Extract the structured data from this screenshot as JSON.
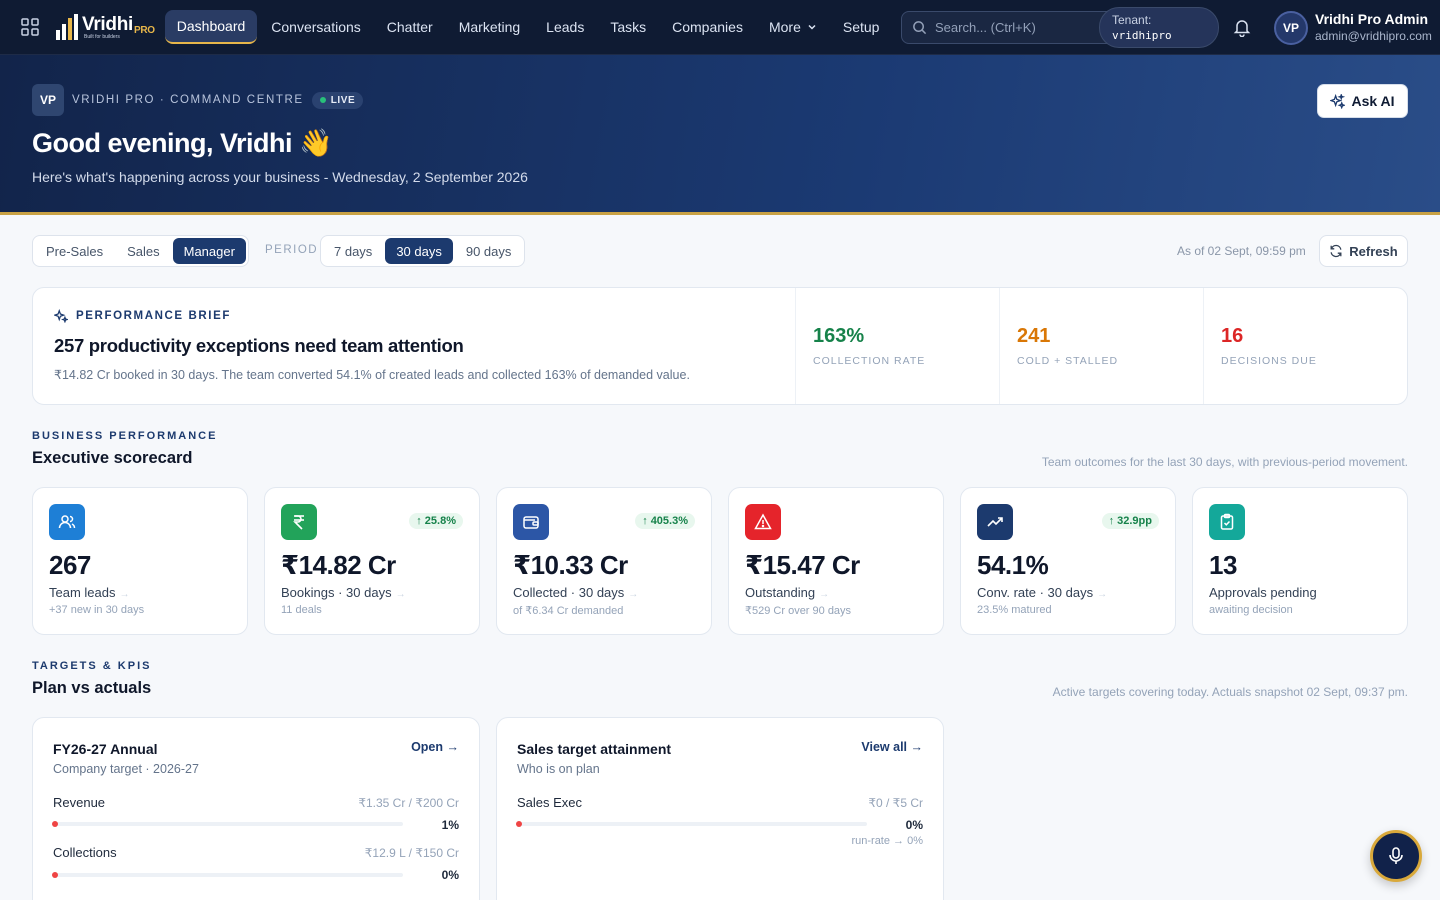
{
  "nav": {
    "logo_name": "Vridhi",
    "logo_suffix": "PRO",
    "logo_tagline": "Built for builders",
    "items": [
      {
        "label": "Dashboard",
        "active": true
      },
      {
        "label": "Conversations"
      },
      {
        "label": "Chatter"
      },
      {
        "label": "Marketing"
      },
      {
        "label": "Leads"
      },
      {
        "label": "Tasks"
      },
      {
        "label": "Companies"
      },
      {
        "label": "More"
      },
      {
        "label": "Setup"
      }
    ],
    "search_placeholder": "Search... (Ctrl+K)",
    "tenant_label": "Tenant:",
    "tenant_value": "vridhipro",
    "avatar_initials": "VP",
    "user_name": "Vridhi Pro Admin",
    "user_email": "admin@vridhipro.com"
  },
  "hero": {
    "badge": "VP",
    "kicker": "VRIDHI PRO · COMMAND CENTRE",
    "live": "LIVE",
    "title": "Good evening, Vridhi 👋",
    "subtitle": "Here's what's happening across your business - Wednesday, 2 September 2026",
    "ask_ai": "Ask AI"
  },
  "toolbar": {
    "views": [
      {
        "label": "Pre-Sales"
      },
      {
        "label": "Sales"
      },
      {
        "label": "Manager",
        "active": true
      }
    ],
    "period_label": "PERIOD",
    "periods": [
      {
        "label": "7 days"
      },
      {
        "label": "30 days",
        "active": true
      },
      {
        "label": "90 days"
      }
    ],
    "as_of": "As of 02 Sept, 09:59 pm",
    "refresh": "Refresh"
  },
  "brief": {
    "kicker": "PERFORMANCE BRIEF",
    "title": "257 productivity exceptions need team attention",
    "text": "₹14.82 Cr booked in 30 days. The team converted 54.1% of created leads and collected 163% of demanded value.",
    "stats": [
      {
        "value": "163%",
        "label": "COLLECTION RATE",
        "color": "#16824a"
      },
      {
        "value": "241",
        "label": "COLD + STALLED",
        "color": "#d97706"
      },
      {
        "value": "16",
        "label": "DECISIONS DUE",
        "color": "#dc2626"
      }
    ]
  },
  "scorecard": {
    "kicker": "BUSINESS PERFORMANCE",
    "title": "Executive scorecard",
    "note": "Team outcomes for the last 30 days, with previous-period movement.",
    "cards": [
      {
        "icon": "users-icon",
        "color": "#1e7fd6",
        "value": "267",
        "label": "Team leads",
        "sub": "+37 new in 30 days",
        "delta": ""
      },
      {
        "icon": "rupee-icon",
        "color": "#22a35a",
        "value": "₹14.82 Cr",
        "label": "Bookings · 30 days",
        "sub": "11 deals",
        "delta": "25.8%"
      },
      {
        "icon": "wallet-icon",
        "color": "#2c56a6",
        "value": "₹10.33 Cr",
        "label": "Collected · 30 days",
        "sub": "of ₹6.34 Cr demanded",
        "delta": "405.3%"
      },
      {
        "icon": "alert-icon",
        "color": "#e5242b",
        "value": "₹15.47 Cr",
        "label": "Outstanding",
        "sub": "₹529 Cr over 90 days",
        "delta": ""
      },
      {
        "icon": "trending-up-icon",
        "color": "#1c3a6e",
        "value": "54.1%",
        "label": "Conv. rate · 30 days",
        "sub": "23.5% matured",
        "delta": "32.9pp"
      },
      {
        "icon": "clipboard-check-icon",
        "color": "#14a89a",
        "value": "13",
        "label": "Approvals pending",
        "sub": "awaiting decision",
        "delta": ""
      }
    ]
  },
  "targets": {
    "kicker": "TARGETS & KPIS",
    "title": "Plan vs actuals",
    "note": "Active targets covering today. Actuals snapshot 02 Sept, 09:37 pm.",
    "annual": {
      "title": "FY26-27 Annual",
      "sub": "Company target · 2026-27",
      "link": "Open →",
      "rows": [
        {
          "label": "Revenue",
          "value": "₹1.35 Cr / ₹200 Cr",
          "pct": "1%",
          "progress": 0.01
        },
        {
          "label": "Collections",
          "value": "₹12.9 L / ₹150 Cr",
          "pct": "0%",
          "progress": 0
        }
      ]
    },
    "sales": {
      "title": "Sales target attainment",
      "sub": "Who is on plan",
      "link": "View all →",
      "rows": [
        {
          "label": "Sales Exec",
          "value": "₹0 / ₹5 Cr",
          "pct": "0%",
          "progress": 0,
          "runrate": "run-rate → 0%"
        }
      ]
    }
  }
}
